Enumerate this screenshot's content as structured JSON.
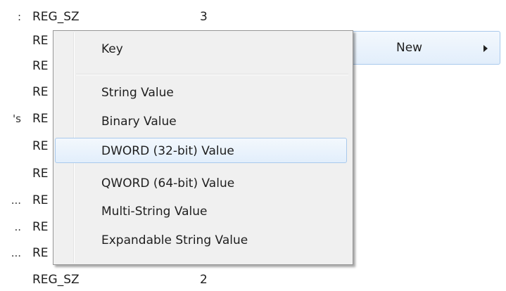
{
  "background_list": {
    "rows": [
      {
        "name": ":",
        "type": "REG_SZ",
        "data": "3"
      },
      {
        "name": "",
        "type": "RE",
        "data": ""
      },
      {
        "name": "",
        "type": "RE",
        "data": ""
      },
      {
        "name": "",
        "type": "RE",
        "data": ""
      },
      {
        "name": "'s",
        "type": "RE",
        "data": ""
      },
      {
        "name": "",
        "type": "RE",
        "data": ""
      },
      {
        "name": "",
        "type": "RE",
        "data": ""
      },
      {
        "name": "...",
        "type": "RE",
        "data": ""
      },
      {
        "name": "..",
        "type": "RE",
        "data": ""
      },
      {
        "name": "...",
        "type": "RE",
        "data": ""
      },
      {
        "name": "",
        "type": "REG_SZ",
        "data": "2"
      }
    ]
  },
  "parent_menu": {
    "new_item": {
      "label": "New",
      "icon": "submenu-arrow-icon"
    }
  },
  "submenu": {
    "items": [
      {
        "label": "Key"
      },
      {
        "label": "String Value"
      },
      {
        "label": "Binary Value"
      },
      {
        "label": "DWORD (32-bit) Value"
      },
      {
        "label": "QWORD (64-bit) Value"
      },
      {
        "label": "Multi-String Value"
      },
      {
        "label": "Expandable String Value"
      }
    ],
    "selected_label": "DWORD (32-bit) Value"
  },
  "colors": {
    "highlight_border": "#a9c9ec",
    "highlight_top": "#f3f8fd",
    "highlight_bottom": "#e2eefb",
    "menu_background": "#f0f0f0"
  }
}
